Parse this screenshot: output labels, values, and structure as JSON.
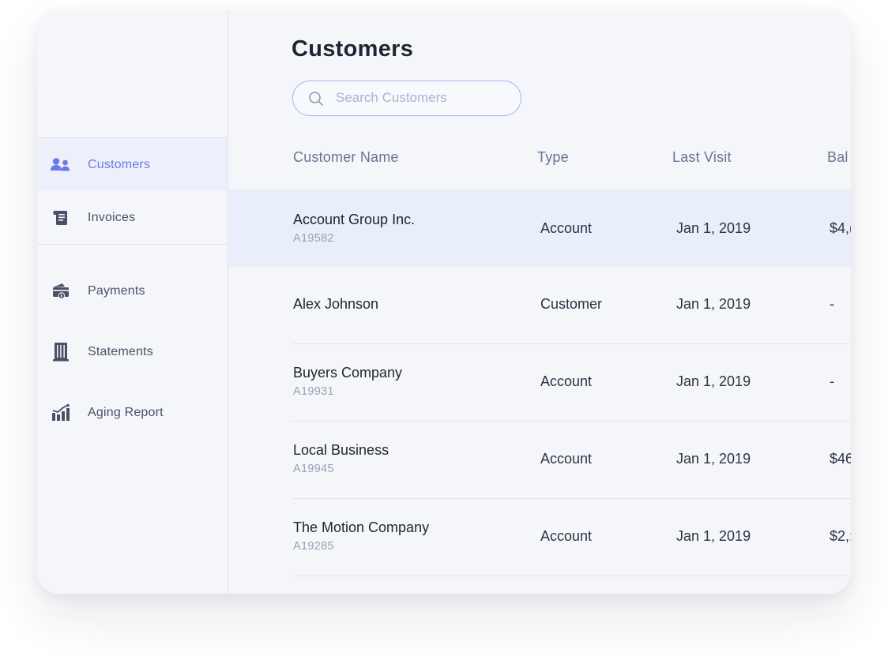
{
  "sidebar": {
    "items": [
      {
        "label": "Customers",
        "icon": "customers-icon",
        "active": true
      },
      {
        "label": "Invoices",
        "icon": "invoices-icon",
        "active": false
      }
    ],
    "secondary_items": [
      {
        "label": "Payments",
        "icon": "payments-icon"
      },
      {
        "label": "Statements",
        "icon": "statements-icon"
      },
      {
        "label": "Aging Report",
        "icon": "aging-report-icon"
      }
    ]
  },
  "main": {
    "title": "Customers",
    "search": {
      "placeholder": "Search Customers",
      "value": ""
    },
    "columns": [
      "Customer Name",
      "Type",
      "Last Visit",
      "Bal"
    ],
    "rows": [
      {
        "name": "Account Group Inc.",
        "id": "A19582",
        "type": "Account",
        "last_visit": "Jan 1, 2019",
        "balance": "$4,("
      },
      {
        "name": "Alex Johnson",
        "id": "",
        "type": "Customer",
        "last_visit": "Jan 1, 2019",
        "balance": "-"
      },
      {
        "name": "Buyers Company",
        "id": "A19931",
        "type": "Account",
        "last_visit": "Jan 1, 2019",
        "balance": "-"
      },
      {
        "name": "Local Business",
        "id": "A19945",
        "type": "Account",
        "last_visit": "Jan 1, 2019",
        "balance": "$46"
      },
      {
        "name": "The Motion Company",
        "id": "A19285",
        "type": "Account",
        "last_visit": "Jan 1, 2019",
        "balance": "$2,;"
      }
    ]
  },
  "colors": {
    "accent": "#6a79e8",
    "icon": "#4a5068",
    "highlight_row": "#e9eefb",
    "background": "#f5f6f9"
  }
}
